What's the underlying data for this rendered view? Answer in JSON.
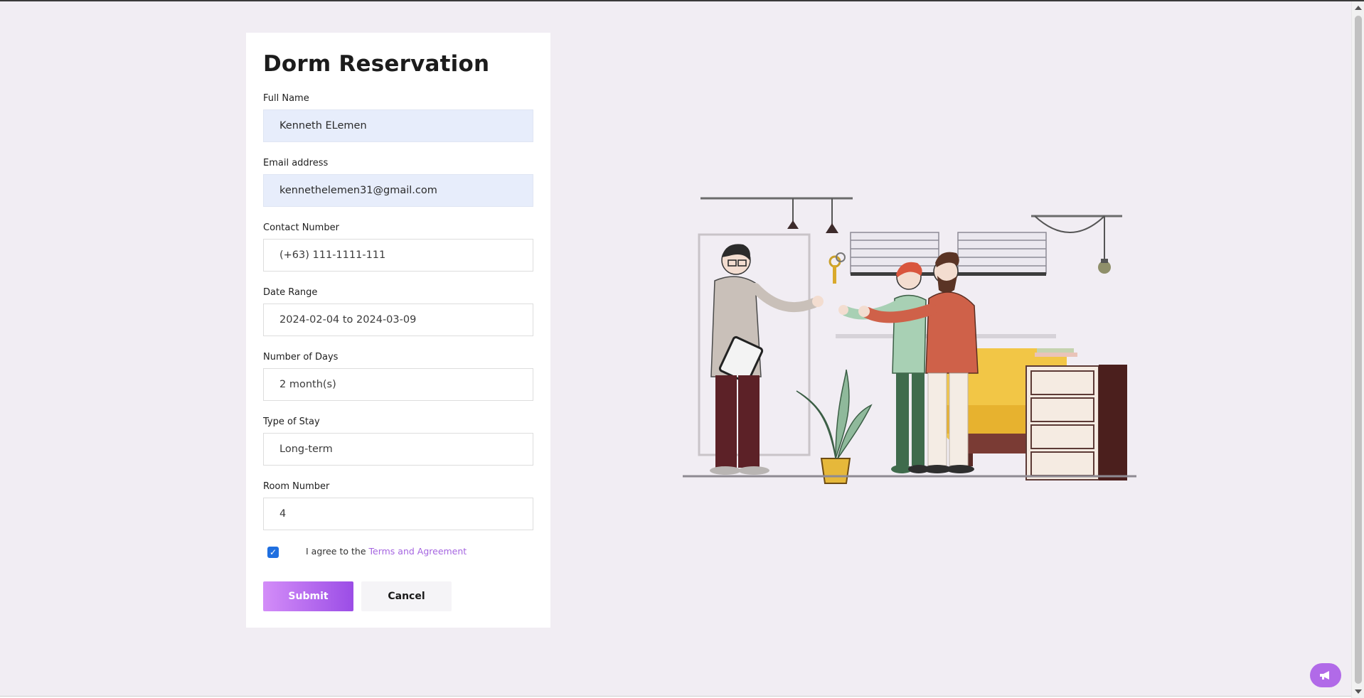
{
  "form": {
    "title": "Dorm Reservation",
    "fields": [
      {
        "label": "Full Name",
        "value": "Kenneth ELemen"
      },
      {
        "label": "Email address",
        "value": "kennethelemen31@gmail.com"
      },
      {
        "label": "Contact Number",
        "value": "(+63) 111-1111-111"
      },
      {
        "label": "Date Range",
        "value": "2024-02-04 to 2024-03-09"
      },
      {
        "label": "Number of Days",
        "value": "2 month(s)"
      },
      {
        "label": "Type of Stay",
        "value": "Long-term"
      },
      {
        "label": "Room Number",
        "value": "4"
      }
    ],
    "agree": {
      "checked": true,
      "prefix": "I agree to the",
      "link": "Terms and Agreement"
    },
    "buttons": {
      "submit": "Submit",
      "cancel": "Cancel"
    }
  },
  "colors": {
    "page_bg": "#f1edf3",
    "accent": "#a565e0",
    "filled_input_bg": "#e7edfb",
    "checkbox": "#1f6fe0"
  },
  "icons": {
    "floating_button": "megaphone-icon",
    "illustration": "people-handshake-illustration"
  }
}
